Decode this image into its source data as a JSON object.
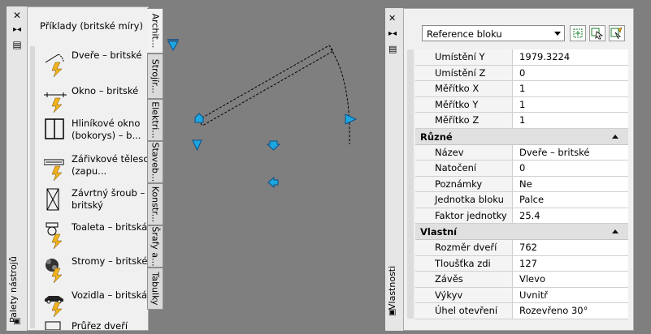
{
  "tool_palette": {
    "title": "Palety nástrojů",
    "palette_title": "Příklady (britské míry)",
    "tools": [
      {
        "label": "Dveře – britské",
        "icon": "door-icon"
      },
      {
        "label": "Okno – britské",
        "icon": "window-icon"
      },
      {
        "label": "Hliníkové okno (bokorys) – b...",
        "icon": "aluminum-window-icon"
      },
      {
        "label": "Zářivkové těleso (zapu...",
        "icon": "fluorescent-fixture-icon"
      },
      {
        "label": "Závrtný šroub – britský",
        "icon": "lag-bolt-icon"
      },
      {
        "label": "Toaleta – britská",
        "icon": "toilet-icon"
      },
      {
        "label": "Stromy – britské",
        "icon": "trees-icon"
      },
      {
        "label": "Vozidla – britská",
        "icon": "vehicles-icon"
      },
      {
        "label": "Průřez dveří",
        "icon": "door-section-icon"
      }
    ],
    "tabs": [
      "Archit...",
      "Strojír...",
      "Elektri...",
      "Staveb...",
      "Konstr...",
      "Šrafy a...",
      "Tabulky"
    ]
  },
  "properties": {
    "title": "Vlastnosti",
    "object_select": "Reference bloku",
    "sections": [
      {
        "name": "",
        "rows": [
          {
            "key": "Umístění Y",
            "value": "1979.3224"
          },
          {
            "key": "Umístění Z",
            "value": "0"
          },
          {
            "key": "Měřítko X",
            "value": "1"
          },
          {
            "key": "Měřítko Y",
            "value": "1"
          },
          {
            "key": "Měřítko Z",
            "value": "1"
          }
        ]
      },
      {
        "name": "Různé",
        "rows": [
          {
            "key": "Název",
            "value": "Dveře – britské"
          },
          {
            "key": "Natočení",
            "value": "0"
          },
          {
            "key": "Poznámky",
            "value": "Ne"
          },
          {
            "key": "Jednotka bloku",
            "value": "Palce"
          },
          {
            "key": "Faktor jednotky",
            "value": "25.4"
          }
        ]
      },
      {
        "name": "Vlastní",
        "rows": [
          {
            "key": "Rozměr dveří",
            "value": "762"
          },
          {
            "key": "Tloušťka zdi",
            "value": "127"
          },
          {
            "key": "Závěs",
            "value": "Vlevo"
          },
          {
            "key": "Výkyv",
            "value": "Uvnitř"
          },
          {
            "key": "Úhel otevření",
            "value": "Rozevřeno 30°"
          }
        ]
      }
    ]
  },
  "colors": {
    "canvas": "#7f7f7f",
    "grip": "#1ca7e0",
    "grip_edge": "#0b4f8a"
  }
}
